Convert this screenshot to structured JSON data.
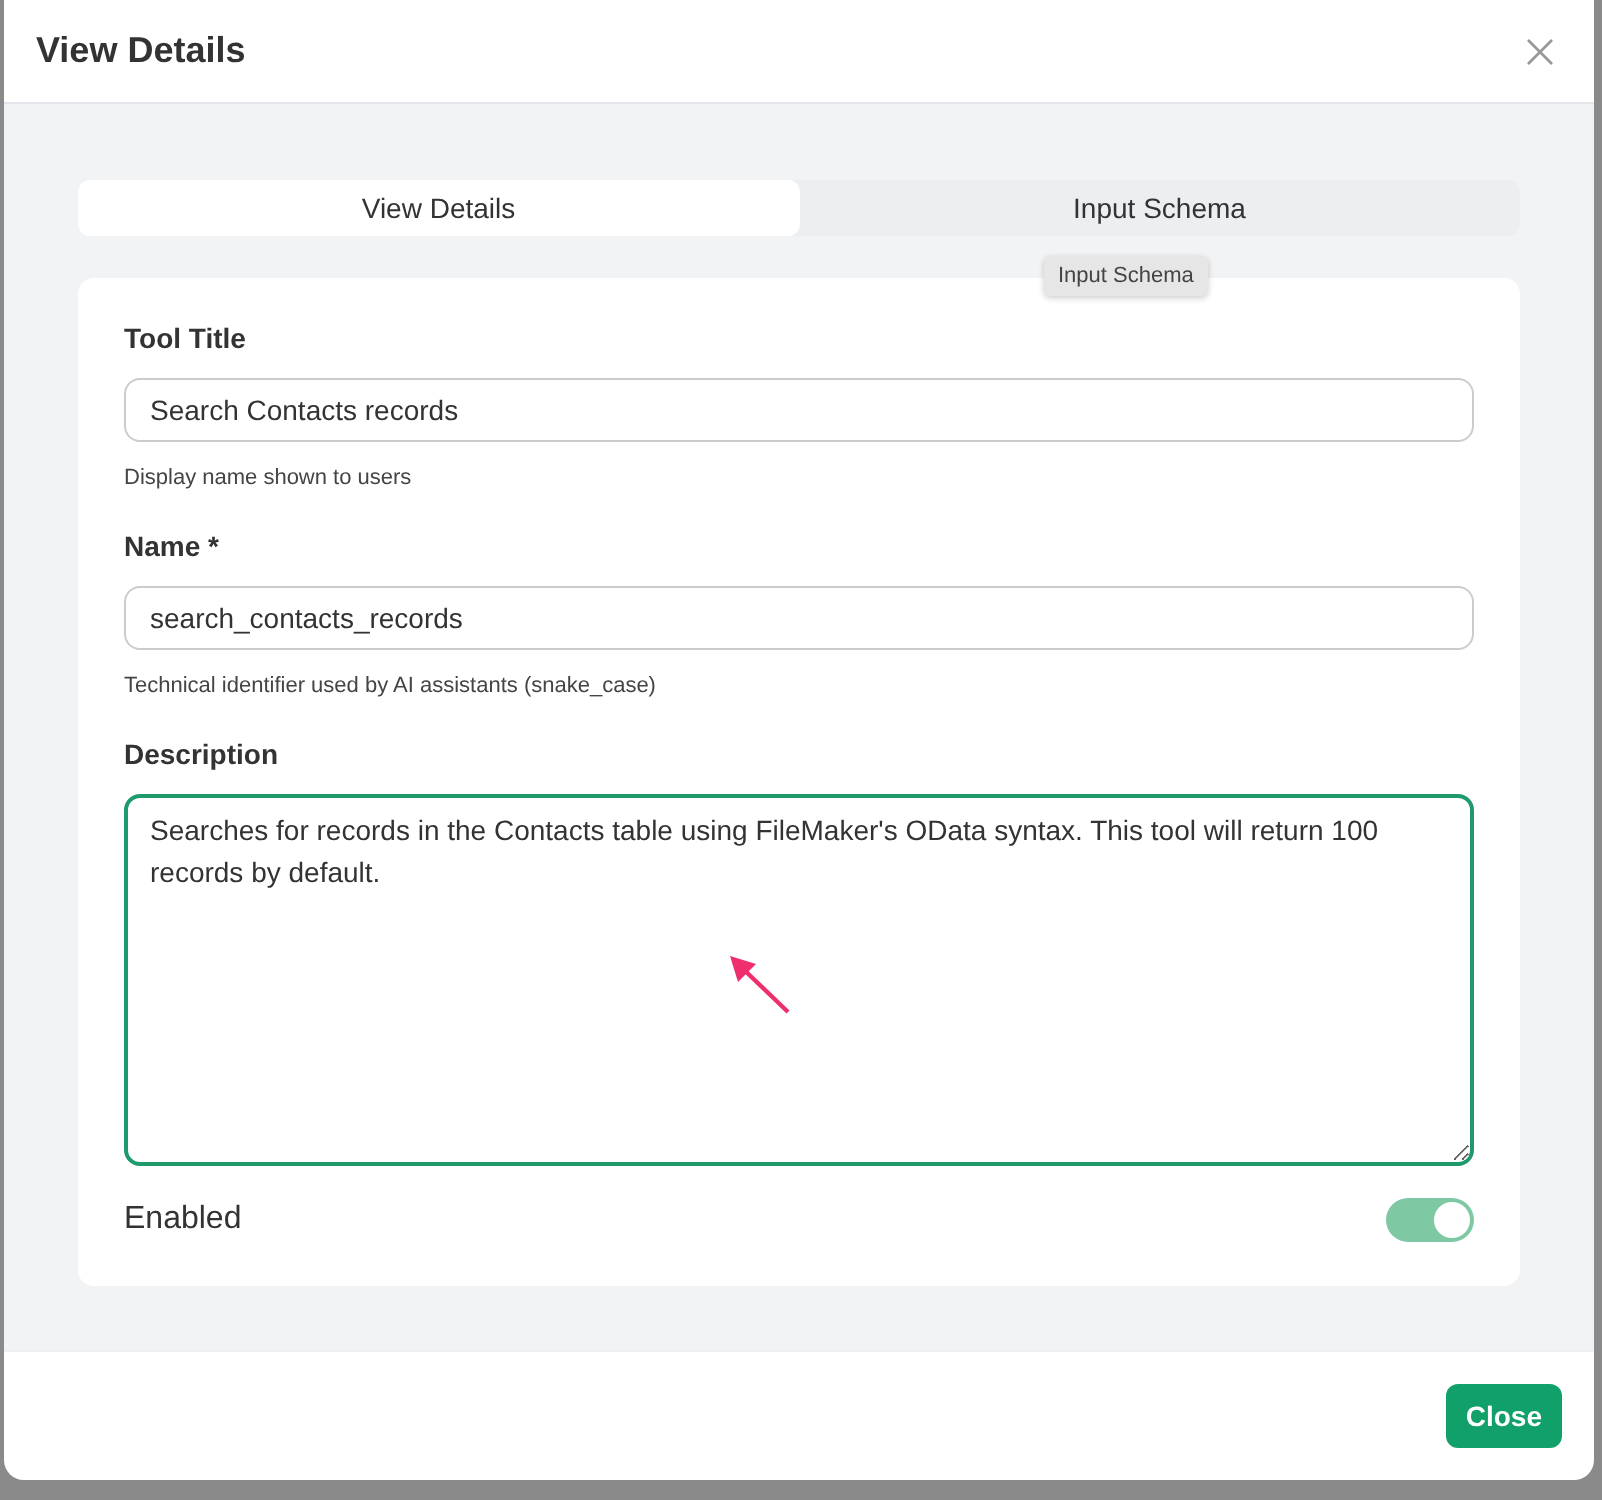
{
  "dialog": {
    "title": "View Details"
  },
  "tabs": [
    {
      "label": "View Details",
      "selected": true
    },
    {
      "label": "Input Schema",
      "selected": false
    }
  ],
  "tooltip": "Input Schema",
  "fields": [
    {
      "label": "Tool Title",
      "value": "Search Contacts records",
      "hint": "Display name shown to users"
    },
    {
      "label": "Name *",
      "value": "search_contacts_records",
      "hint": "Technical identifier used by AI assistants (snake_case)"
    }
  ],
  "description": {
    "label": "Description",
    "value": "Searches for records in the Contacts table using FileMaker's OData syntax. This tool will return 100 records by default.",
    "focused": true
  },
  "enabled": {
    "label": "Enabled",
    "on": true
  },
  "footer": {
    "close_button": "Close"
  }
}
